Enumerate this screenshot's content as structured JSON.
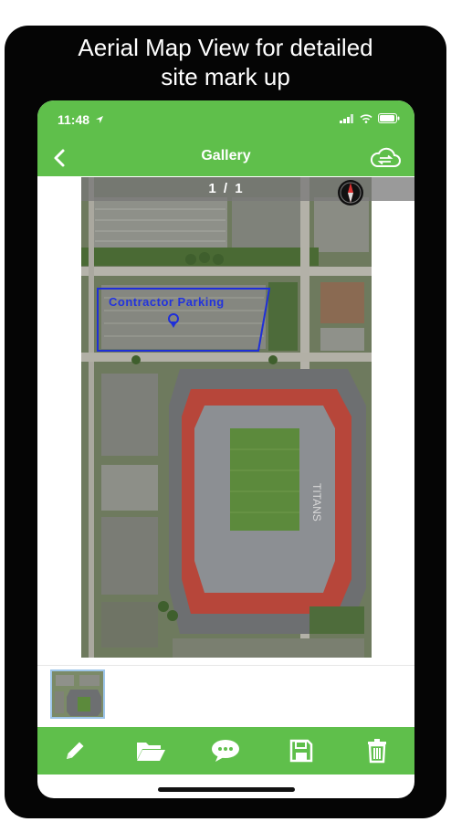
{
  "headline": {
    "line1": "Aerial Map View for detailed",
    "line2": "site mark up"
  },
  "status_bar": {
    "time": "11:48",
    "icons": [
      "location-arrow-icon",
      "signal-icon",
      "wifi-icon",
      "battery-icon"
    ]
  },
  "app_bar": {
    "title": "Gallery",
    "back_icon": "chevron-left-icon",
    "sync_icon": "cloud-sync-icon"
  },
  "viewer": {
    "counter": "1 / 1",
    "compass_icon": "compass-icon",
    "markup_label": "Contractor Parking",
    "markup_pin_icon": "map-pin-icon"
  },
  "toolbar": {
    "items": [
      "pencil-icon",
      "folder-open-icon",
      "comment-icon",
      "save-icon",
      "trash-icon"
    ]
  },
  "colors": {
    "accent": "#5fbf4b",
    "markup": "#2233dd",
    "frame": "#050505"
  }
}
